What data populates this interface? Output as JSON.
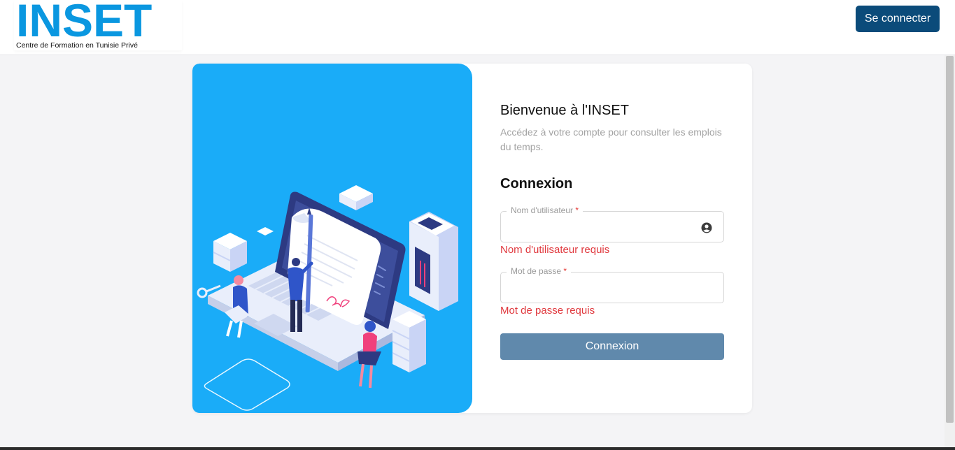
{
  "header": {
    "logo_text": "INSET",
    "logo_subtitle": "Centre de Formation en Tunisie Privé",
    "connect_button": "Se connecter"
  },
  "welcome": {
    "title": "Bienvenue à l'INSET",
    "subtitle": "Accédez à votre compte pour consulter les emplois du temps."
  },
  "login": {
    "section_title": "Connexion",
    "username": {
      "label": "Nom d'utilisateur",
      "required_mark": "*",
      "value": "",
      "error": "Nom d'utilisateur requis",
      "icon": "account-circle-icon"
    },
    "password": {
      "label": "Mot de passe",
      "required_mark": "*",
      "value": "",
      "error": "Mot de passe requis"
    },
    "submit_label": "Connexion"
  },
  "colors": {
    "brand_blue": "#0a97e0",
    "nav_button": "#0b4b7a",
    "illustration_bg": "#1aacf8",
    "error": "#e0393e",
    "submit_button": "#6089ac"
  }
}
